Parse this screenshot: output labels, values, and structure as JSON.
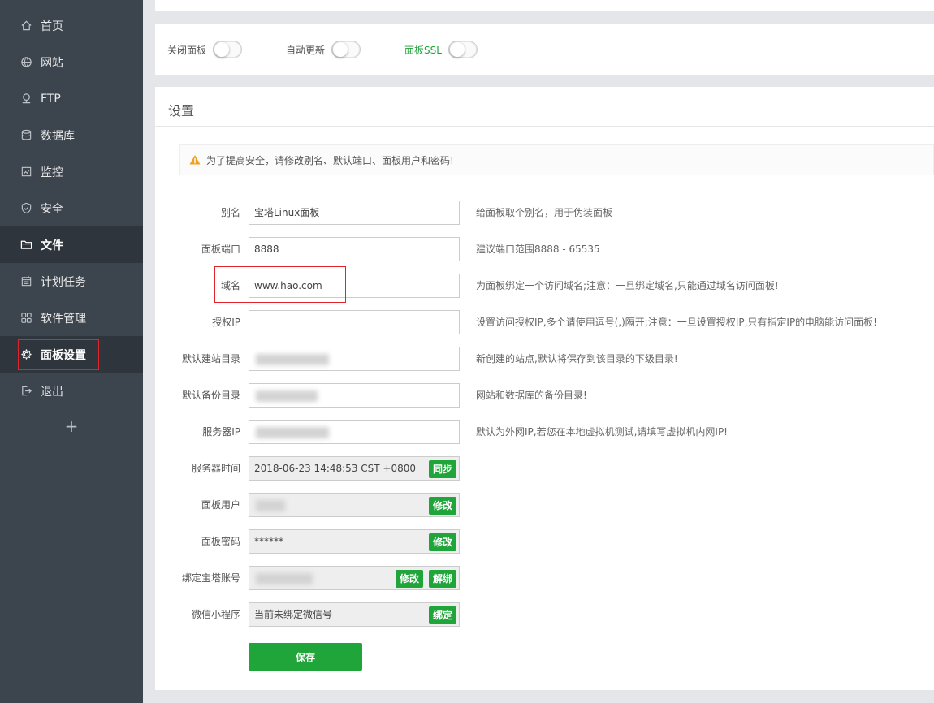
{
  "sidebar": {
    "items": [
      {
        "label": "首页",
        "icon": "home-icon"
      },
      {
        "label": "网站",
        "icon": "globe-icon"
      },
      {
        "label": "FTP",
        "icon": "ftp-icon"
      },
      {
        "label": "数据库",
        "icon": "database-icon"
      },
      {
        "label": "监控",
        "icon": "monitor-icon"
      },
      {
        "label": "安全",
        "icon": "shield-icon"
      },
      {
        "label": "文件",
        "icon": "folder-icon"
      },
      {
        "label": "计划任务",
        "icon": "calendar-icon"
      },
      {
        "label": "软件管理",
        "icon": "grid-icon"
      },
      {
        "label": "面板设置",
        "icon": "gear-icon"
      },
      {
        "label": "退出",
        "icon": "logout-icon"
      }
    ],
    "add_label": "+"
  },
  "toggles": {
    "close_panel": {
      "label": "关闭面板",
      "on": false
    },
    "auto_update": {
      "label": "自动更新",
      "on": false
    },
    "panel_ssl": {
      "label": "面板SSL",
      "on": false
    }
  },
  "settings": {
    "title": "设置",
    "warning": "为了提高安全，请修改别名、默认端口、面板用户和密码!",
    "alias": {
      "label": "别名",
      "value": "宝塔Linux面板",
      "hint": "给面板取个别名，用于伪装面板"
    },
    "port": {
      "label": "面板端口",
      "value": "8888",
      "hint": "建议端口范围8888 - 65535"
    },
    "domain": {
      "label": "域名",
      "value": "www.hao.com",
      "hint": "为面板绑定一个访问域名;注意：一旦绑定域名,只能通过域名访问面板!"
    },
    "auth_ip": {
      "label": "授权IP",
      "value": "",
      "hint": "设置访问授权IP,多个请使用逗号(,)隔开;注意：一旦设置授权IP,只有指定IP的电脑能访问面板!"
    },
    "site_dir": {
      "label": "默认建站目录",
      "hint": "新创建的站点,默认将保存到该目录的下级目录!"
    },
    "backup_dir": {
      "label": "默认备份目录",
      "hint": "网站和数据库的备份目录!"
    },
    "server_ip": {
      "label": "服务器IP",
      "hint": "默认为外网IP,若您在本地虚拟机测试,请填写虚拟机内网IP!"
    },
    "server_time": {
      "label": "服务器时间",
      "value": "2018-06-23 14:48:53 CST +0800",
      "button": "同步"
    },
    "panel_user": {
      "label": "面板用户",
      "button": "修改"
    },
    "panel_password": {
      "label": "面板密码",
      "value": "******",
      "button": "修改"
    },
    "bt_account": {
      "label": "绑定宝塔账号",
      "button_edit": "修改",
      "button_unbind": "解绑"
    },
    "wechat": {
      "label": "微信小程序",
      "value": "当前未绑定微信号",
      "button": "绑定"
    },
    "save_label": "保存"
  },
  "colors": {
    "sidebar": "#3c444d",
    "sidebar_active": "#2f353c",
    "accent_green": "#20a53a",
    "highlight_red": "#e0242a"
  }
}
